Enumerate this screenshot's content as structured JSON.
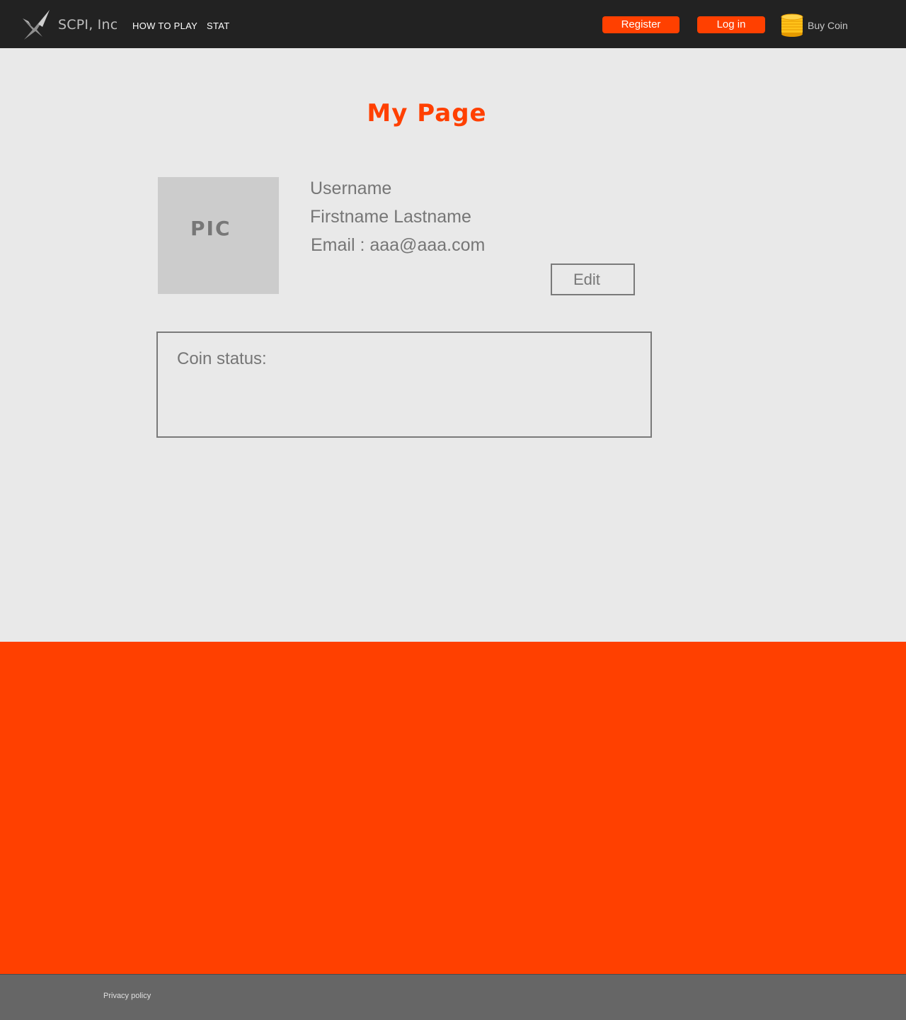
{
  "header": {
    "brand": "SCPI, Inc",
    "nav": [
      {
        "label": "HOW TO PLAY"
      },
      {
        "label": "STAT"
      }
    ],
    "register_label": "Register",
    "login_label": "Log in",
    "buy_coin_label": "Buy Coin",
    "logo_icon": "logo-icon",
    "coin_icon": "coin-stack-icon"
  },
  "main": {
    "title": "My Page",
    "profile": {
      "pic_label": "PIC",
      "username": "Username",
      "full_name": "Firstname Lastname",
      "email_line": "Email : aaa@aaa.com"
    },
    "edit_label": "Edit",
    "coin_status_label": "Coin status:"
  },
  "footer": {
    "privacy_label": "Privacy policy"
  },
  "colors": {
    "accent": "#ff4000",
    "header_bg": "#222222",
    "page_bg": "#e9e9e9",
    "footer_bg": "#666666"
  }
}
